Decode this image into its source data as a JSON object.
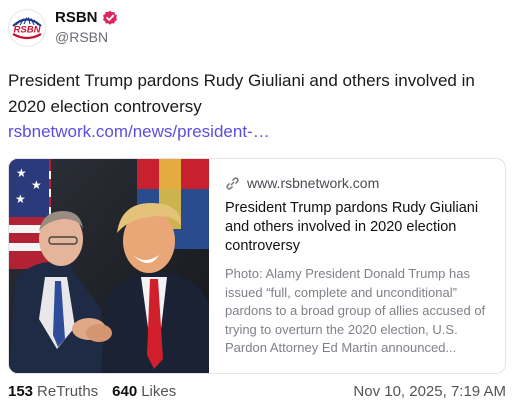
{
  "account": {
    "display_name": "RSBN",
    "handle": "@RSBN",
    "avatar_logo_text": "RSBN",
    "verified_icon": "verified-badge-icon",
    "verified_color": "#e0245e"
  },
  "post": {
    "text": "President Trump pardons Rudy Giuliani and others involved in 2020 election controversy",
    "link_text": "rsbnetwork.com/news/president-…",
    "link_color": "#5b4ee0"
  },
  "link_card": {
    "link_icon": "link-icon",
    "domain": "www.rsbnetwork.com",
    "title": "President Trump pardons Rudy Giuliani and others involved in 2020 election controversy",
    "description": "Photo: Alamy President Donald Trump has issued “full, complete and unconditional” pardons to a broad group of allies accused of trying to overturn the 2020 election, U.S. Pardon Attorney Ed Martin announced..."
  },
  "footer": {
    "retruths_count": "153",
    "retruths_label": "ReTruths",
    "likes_count": "640",
    "likes_label": "Likes",
    "timestamp": "Nov 10, 2025, 7:19 AM"
  }
}
